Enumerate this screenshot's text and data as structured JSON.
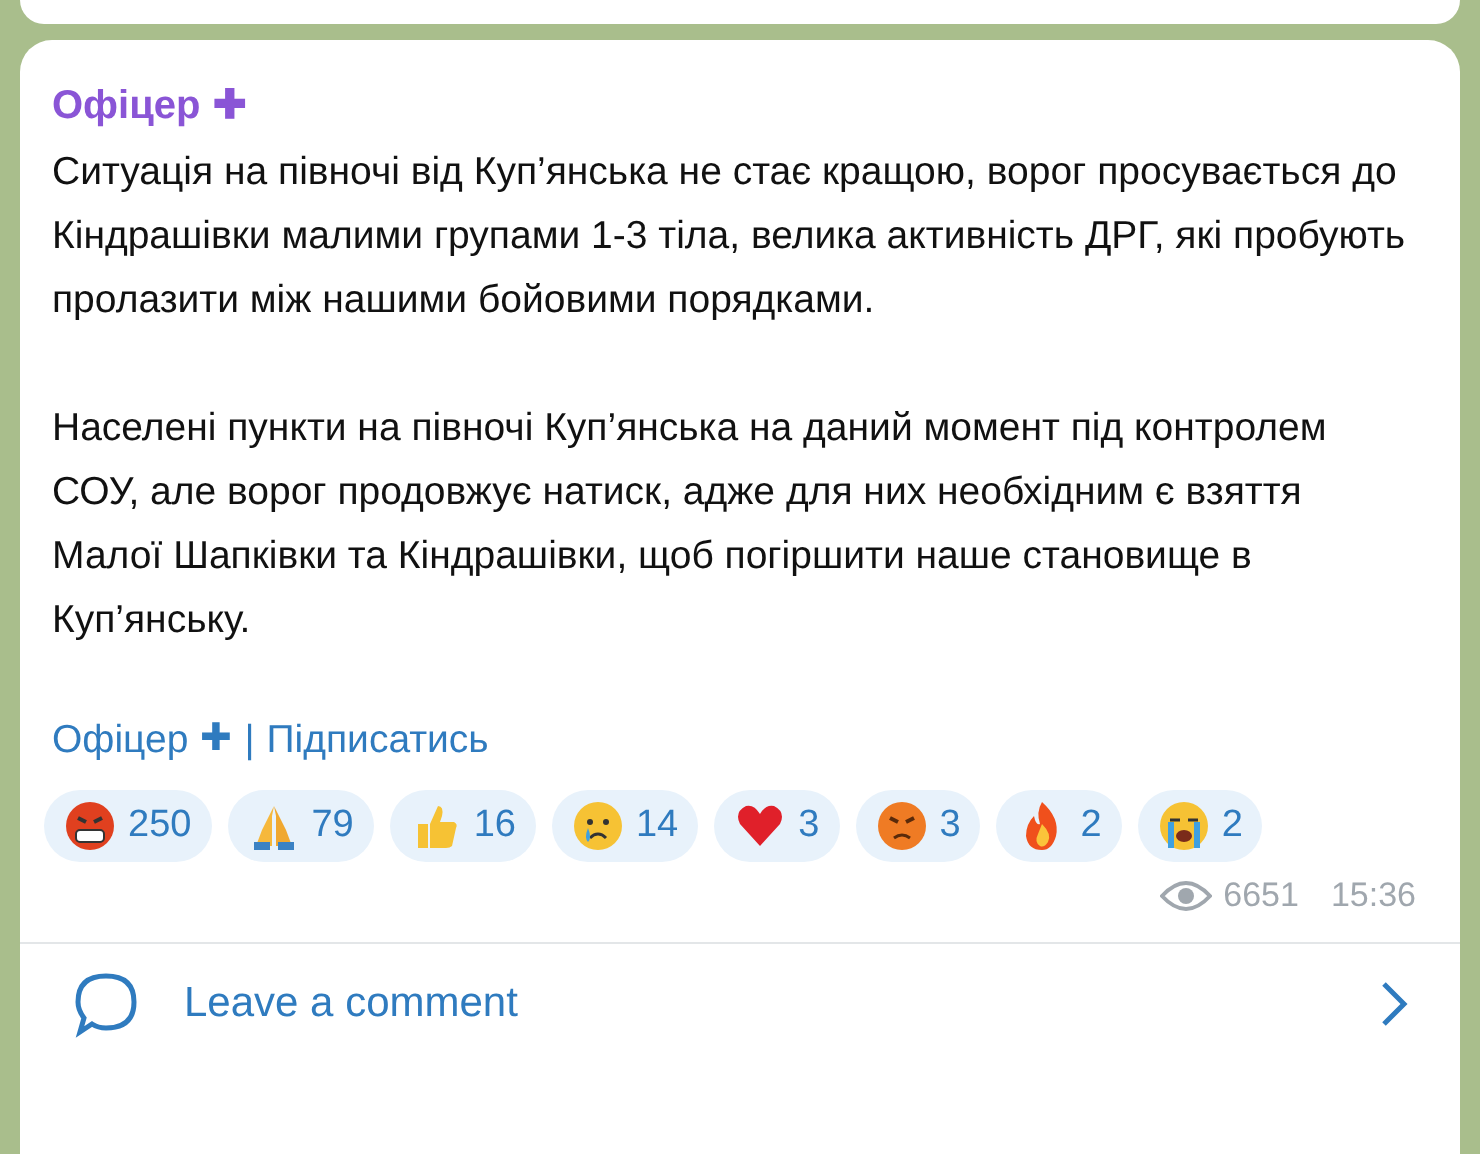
{
  "post": {
    "author": "Офіцер",
    "author_badge": "✚",
    "paragraphs": [
      "Ситуація на півночі від Куп’янська не стає кращою, ворог просувається до Кіндрашівки малими групами 1-3 тіла, велика активність ДРГ, які пробують пролазити між нашими бойовими порядками.",
      "Населені пункти на півночі Куп’янська на даний момент під контролем СОУ, але ворог продовжує натиск, адже для них необхідним є взяття Малої Шапківки та Кіндрашівки, щоб погіршити наше становище в Куп’янську."
    ],
    "signature": {
      "name": "Офіцер",
      "badge": "✚",
      "separator": "|",
      "link": "Підписатись"
    },
    "reactions": [
      {
        "kind": "cursing",
        "count": "250"
      },
      {
        "kind": "pray",
        "count": "79"
      },
      {
        "kind": "thumbs",
        "count": "16"
      },
      {
        "kind": "crying",
        "count": "14"
      },
      {
        "kind": "heart",
        "count": "3"
      },
      {
        "kind": "angry",
        "count": "3"
      },
      {
        "kind": "fire",
        "count": "2"
      },
      {
        "kind": "sobbing",
        "count": "2"
      }
    ],
    "views": "6651",
    "time": "15:36"
  },
  "comment_bar": {
    "label": "Leave a comment"
  }
}
